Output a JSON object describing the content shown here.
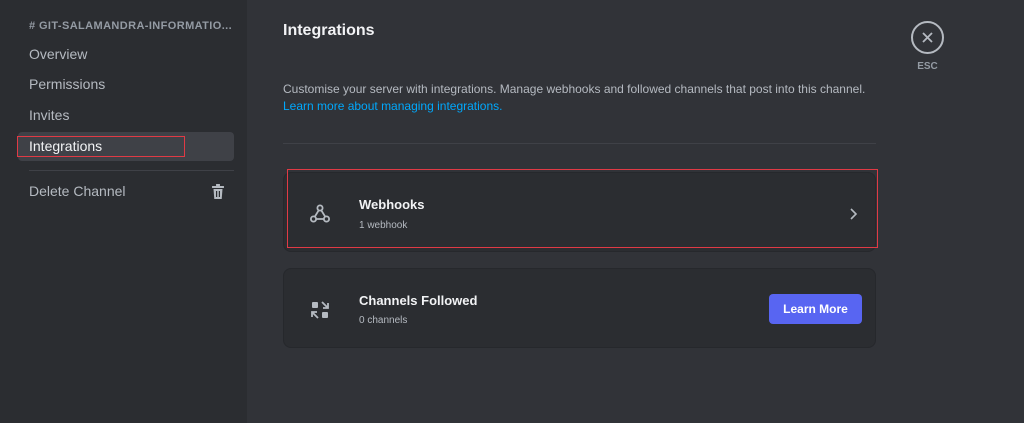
{
  "sidebar": {
    "channel_title": "# GIT-SALAMANDRA-INFORMATIO...",
    "items": [
      {
        "label": "Overview"
      },
      {
        "label": "Permissions"
      },
      {
        "label": "Invites"
      },
      {
        "label": "Integrations"
      }
    ],
    "delete_label": "Delete Channel"
  },
  "main": {
    "title": "Integrations",
    "description": "Customise your server with integrations. Manage webhooks and followed channels that post into this channel.",
    "learn_link": "Learn more about managing integrations.",
    "webhooks": {
      "title": "Webhooks",
      "subtitle": "1 webhook",
      "icon": "webhook-icon"
    },
    "channels_followed": {
      "title": "Channels Followed",
      "subtitle": "0 channels",
      "button": "Learn More",
      "icon": "channels-followed-icon"
    }
  },
  "esc": {
    "label": "ESC"
  },
  "colors": {
    "accent": "#5865f2",
    "highlight": "#e03a45",
    "link": "#00a8fc"
  }
}
